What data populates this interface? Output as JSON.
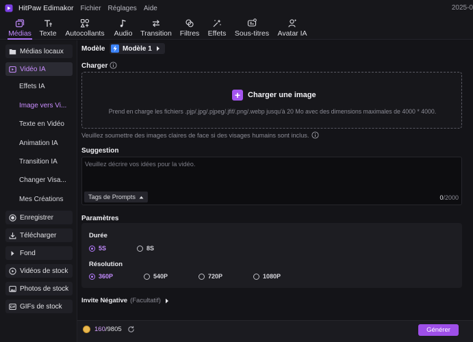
{
  "titlebar": {
    "app_name": "HitPaw Edimakor",
    "menu": [
      "Fichier",
      "Réglages",
      "Aide"
    ],
    "date_fragment": "2025-0"
  },
  "toolbar": {
    "tabs": [
      {
        "label": "Médias",
        "icon": "media-icon",
        "active": true
      },
      {
        "label": "Texte",
        "icon": "text-icon"
      },
      {
        "label": "Autocollants",
        "icon": "sticker-icon"
      },
      {
        "label": "Audio",
        "icon": "music-note-icon"
      },
      {
        "label": "Transition",
        "icon": "transition-arrows-icon"
      },
      {
        "label": "Filtres",
        "icon": "filter-icon"
      },
      {
        "label": "Effets",
        "icon": "effects-sparkle-icon"
      },
      {
        "label": "Sous-titres",
        "icon": "subtitles-icon"
      },
      {
        "label": "Avatar IA",
        "icon": "avatar-ai-icon"
      }
    ]
  },
  "sidebar": {
    "items": [
      {
        "label": "Médias locaux",
        "icon": "folder-icon"
      },
      {
        "label": "Vidéo IA",
        "icon": "ai-video-icon",
        "active": true
      },
      {
        "label": "Effets IA",
        "sub": true
      },
      {
        "label": "Image vers Vi...",
        "sub": true,
        "selected": true
      },
      {
        "label": "Texte en Vidéo",
        "sub": true
      },
      {
        "label": "Animation IA",
        "sub": true
      },
      {
        "label": "Transition IA",
        "sub": true
      },
      {
        "label": "Changer Visa...",
        "sub": true
      },
      {
        "label": "Mes Créations",
        "sub": true
      },
      {
        "label": "Enregistrer",
        "icon": "record-icon"
      },
      {
        "label": "Télécharger",
        "icon": "download-icon"
      },
      {
        "label": "Fond",
        "icon": "background-arrow-icon"
      },
      {
        "label": "Vidéos de stock",
        "icon": "stock-video-icon"
      },
      {
        "label": "Photos de stock",
        "icon": "stock-photo-icon"
      },
      {
        "label": "GIFs de stock",
        "icon": "gif-icon"
      }
    ]
  },
  "main": {
    "model_label": "Modèle",
    "model_value": "Modèle 1",
    "upload_label": "Charger",
    "upload_button": "Charger une image",
    "upload_desc": "Prend en charge les fichiers .pjp/.jpg/.pjpeg/.jfif/.png/.webp jusqu'à 20 Mo avec des dimensions maximales de 4000 * 4000.",
    "upload_hint": "Veuillez soumettre des images claires de face si des visages humains sont inclus.",
    "suggestion_label": "Suggestion",
    "suggestion_placeholder": "Veuillez décrire vos idées pour la vidéo.",
    "suggestion_value": "",
    "tags_button": "Tags de Prompts",
    "char_count_current": "0",
    "char_count_max": "/2000",
    "params_label": "Paramètres",
    "duration_label": "Durée",
    "duration_options": [
      "5S",
      "8S"
    ],
    "duration_selected": "5S",
    "resolution_label": "Résolution",
    "resolution_options": [
      "360P",
      "540P",
      "720P",
      "1080P"
    ],
    "resolution_selected": "360P",
    "negative_label": "Invite Négative",
    "negative_optional": "(Facultatif)"
  },
  "footer": {
    "credits_used": "160",
    "credits_total": "/9805",
    "generate_button": "Générer"
  },
  "colors": {
    "accent": "#a455f0",
    "accent_text": "#c28bff",
    "background": "#141418",
    "panel": "#1d1d22"
  }
}
